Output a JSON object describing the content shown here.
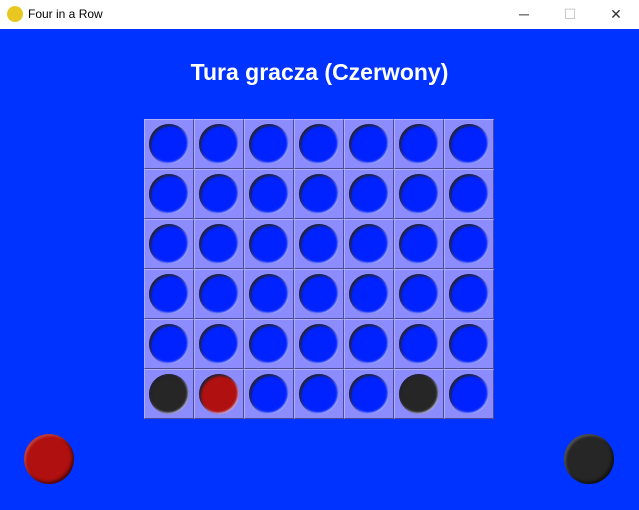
{
  "window": {
    "title": "Four in a Row",
    "icon": "python-icon",
    "minimize": "─",
    "maximize": "☐",
    "close": "✕"
  },
  "status": "Tura gracza (Czerwony)",
  "colors": {
    "background": "#0033ff",
    "cell": "#8c8cff",
    "red": "#b01010",
    "black": "#262626"
  },
  "board": [
    [
      "empty",
      "empty",
      "empty",
      "empty",
      "empty",
      "empty",
      "empty"
    ],
    [
      "empty",
      "empty",
      "empty",
      "empty",
      "empty",
      "empty",
      "empty"
    ],
    [
      "empty",
      "empty",
      "empty",
      "empty",
      "empty",
      "empty",
      "empty"
    ],
    [
      "empty",
      "empty",
      "empty",
      "empty",
      "empty",
      "empty",
      "empty"
    ],
    [
      "empty",
      "empty",
      "empty",
      "empty",
      "empty",
      "empty",
      "empty"
    ],
    [
      "black",
      "red",
      "empty",
      "empty",
      "empty",
      "black",
      "empty"
    ]
  ],
  "piles": {
    "left": "red",
    "right": "black"
  }
}
